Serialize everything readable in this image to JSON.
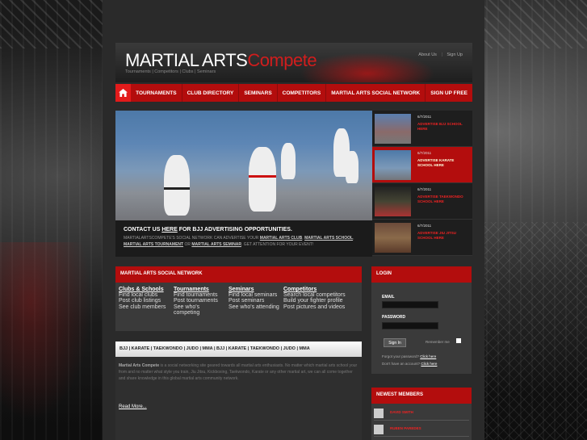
{
  "header": {
    "logo_main": "MARTIAL ARTS",
    "logo_accent": "Compete",
    "tagline": "Tournaments | Competitors | Clubs | Seminars",
    "about_us": "About Us",
    "separator": "|",
    "sign_up": "Sign Up"
  },
  "nav": {
    "home_icon": "home-icon",
    "items": [
      "TOURNAMENTS",
      "CLUB DIRECTORY",
      "SEMINARS",
      "COMPETITORS",
      "MARTIAL ARTS SOCIAL NETWORK",
      "SIGN UP FREE"
    ]
  },
  "slider": {
    "headline_pre": "CONTACT US ",
    "headline_link": "HERE",
    "headline_post": " FOR BJJ ADVERTISING OPPORTUNITIES.",
    "body_1": "MARTIALARTSCOMPETE'S SOCIAL NETWORK CAN ADVERTISE YOUR ",
    "link_club": "MARTIAL ARTS CLUB",
    "comma": ", ",
    "link_school": "MARTIAL ARTS SCHOOL",
    "link_tournament": "MARTIAL ARTS TOURNAMENT",
    "or": " OR ",
    "link_seminar": "MARTIAL ARTS SEMINAR",
    "body_2": ". GET ATTENTION FOR YOUR EVENT!",
    "thumbs": [
      {
        "date": "6/7/2011",
        "desc": "ADVERTISE BJJ SCHOOL HERE"
      },
      {
        "date": "6/7/2011",
        "desc": "ADVERTISE KARATE SCHOOL HERE"
      },
      {
        "date": "6/7/2011",
        "desc": "ADVERTISE TAEKWONDO SCHOOL HERE"
      },
      {
        "date": "6/7/2011",
        "desc": "ADVERTISE JIU JITSU SCHOOL HERE"
      }
    ]
  },
  "social_network": {
    "title": "MARTIAL ARTS SOCIAL NETWORK",
    "columns": [
      {
        "heading": "Clubs & Schools",
        "lines": [
          "Find local clubs",
          "Post club listings",
          "See club members"
        ]
      },
      {
        "heading": "Tournaments",
        "lines": [
          "Find tournaments",
          "Post tournaments",
          "See who's",
          "competing"
        ]
      },
      {
        "heading": "Seminars",
        "lines": [
          "Find local seminars",
          "Post seminars",
          "See who's attending"
        ]
      },
      {
        "heading": "Competitors",
        "lines": [
          "Search local competitors",
          "Build your fighter profile",
          "Post pictures and videos"
        ]
      }
    ]
  },
  "login": {
    "title": "LOGIN",
    "email_label": "EMAIL",
    "password_label": "PASSWORD",
    "signin": "Sign In",
    "remember": "Remember me",
    "forgot_pre": "Forgot your password? ",
    "forgot_link": "Click here",
    "noaccount_pre": "Don't have an account? ",
    "noaccount_link": "Click here"
  },
  "keywords": {
    "bar": "BJJ | KARATE | TAEKWONDO | JUDO | MMA | BJJ | KARATE | TAEKWONDO | JUDO | MMA",
    "body_bold": "Martial Arts Compete",
    "body": " is a social networking site geared towards all martial arts enthusiasts. No matter which martial arts school your from and no matter what style you train, Jiu Jitsu, Kickboxing, Taekwondo, Karate or any other martial art, we can all come together and share knowledge in this global martial arts community network.",
    "read_more": "Read More..."
  },
  "newest_members": {
    "title": "NEWEST MEMBERS",
    "members": [
      "DAVID SMITH",
      "RUBEN PAREDES"
    ]
  },
  "colors": {
    "brand_red": "#b30d0d",
    "accent_red": "#d11d1d"
  }
}
